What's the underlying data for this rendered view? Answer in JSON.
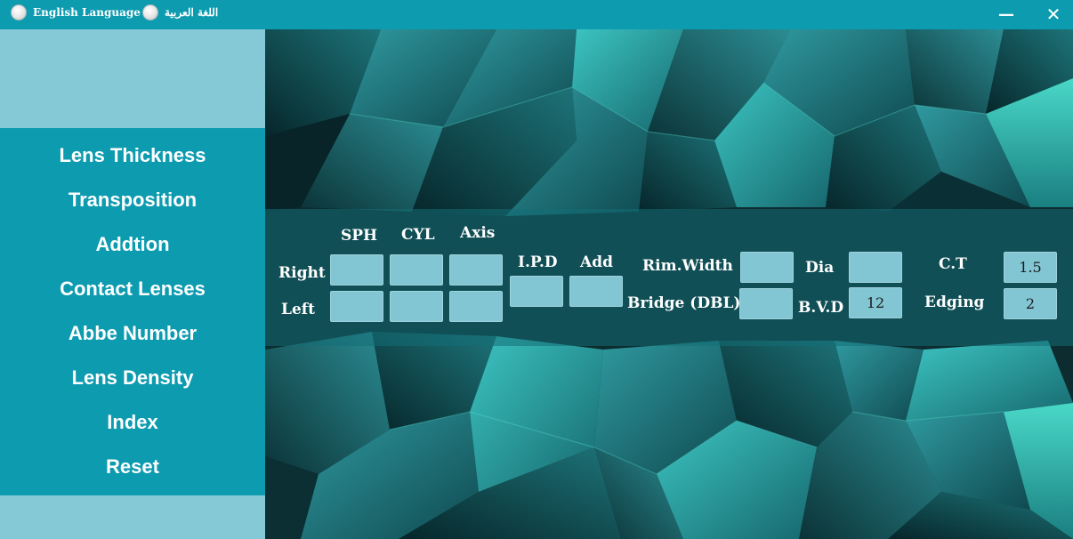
{
  "titlebar": {
    "lang_english": "English Language",
    "lang_arabic": "اللغة العربية",
    "minimize_glyph": "—",
    "close_glyph": "✕"
  },
  "sidebar": {
    "items": [
      {
        "label": "Lens Thickness"
      },
      {
        "label": "Transposition"
      },
      {
        "label": "Addtion"
      },
      {
        "label": "Contact Lenses"
      },
      {
        "label": "Abbe Number"
      },
      {
        "label": "Lens Density"
      },
      {
        "label": "Index"
      },
      {
        "label": "Reset"
      }
    ]
  },
  "form": {
    "headers": {
      "sph": "SPH",
      "cyl": "CYL",
      "axis": "Axis",
      "ipd": "I.P.D",
      "add": "Add"
    },
    "rows": {
      "right": "Right",
      "left": "Left"
    },
    "rim_width_label": "Rim.Width",
    "bridge_label": "Bridge (DBL)",
    "dia_label": "Dia",
    "bvd_label": "B.V.D",
    "ct_label": "C.T",
    "edging_label": "Edging",
    "values": {
      "right_sph": "",
      "right_cyl": "",
      "right_axis": "",
      "left_sph": "",
      "left_cyl": "",
      "left_axis": "",
      "ipd": "",
      "add": "",
      "rim_width": "",
      "bridge": "",
      "dia": "",
      "bvd": "12",
      "ct": "1.5",
      "edging": "2"
    }
  },
  "colors": {
    "titlebar": "#0d9bb0",
    "sidebar_menu": "#0d9bb0",
    "sidebar_light": "#85c9d6",
    "field_bg": "#82c6d3",
    "panel_overlay": "#146e76"
  }
}
